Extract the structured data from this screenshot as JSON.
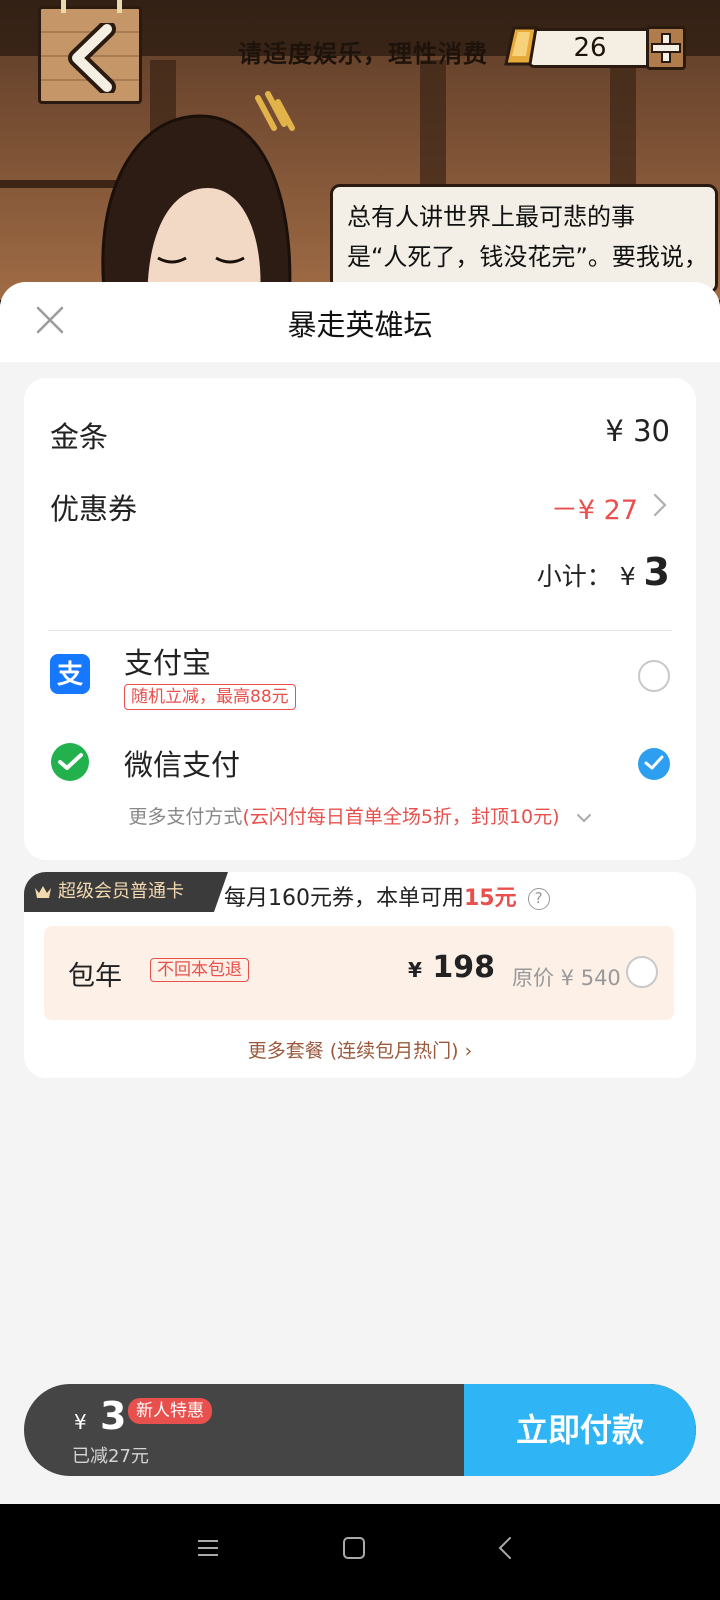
{
  "game": {
    "slogan": "请适度娱乐，理性消费",
    "gold_count": "26",
    "dialog_line1": "总有人讲世界上最可悲的事",
    "dialog_line2": "是“人死了，钱没花完”。要我说，"
  },
  "sheet": {
    "title": "暴走英雄坛"
  },
  "order": {
    "item_label": "金条",
    "item_price": "¥ 30",
    "coupon_label": "优惠券",
    "coupon_value": "－¥ 27",
    "subtotal_label": "小计：",
    "subtotal_currency": "¥",
    "subtotal_value": "3"
  },
  "payment": {
    "alipay_label": "支付宝",
    "alipay_promo": "随机立减，最高88元",
    "wechat_label": "微信支付",
    "selected": "wechat",
    "more_prefix": "更多支付方式",
    "more_highlight": "(云闪付每日首单全场5折，封顶10元)"
  },
  "vip": {
    "badge": "超级会员普通卡",
    "desc_prefix": "每月160元券，本单可用",
    "desc_highlight": "15元",
    "help": "?",
    "plan_name": "包年",
    "plan_tag": "不回本包退",
    "plan_currency": "¥",
    "plan_price": "198",
    "plan_original": "原价 ¥ 540",
    "more_plans": "更多套餐 (连续包月热门) ›"
  },
  "pay_bar": {
    "currency": "¥",
    "total": "3",
    "newbie_tag": "新人特惠",
    "saved": "已减27元",
    "pay_button": "立即付款"
  },
  "colors": {
    "accent_blue": "#2fb4f5",
    "discount_red": "#e8504d",
    "wechat_green": "#23b14d",
    "alipay_blue": "#1677ff"
  }
}
